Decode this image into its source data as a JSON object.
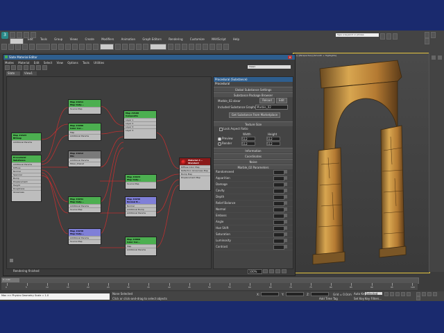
{
  "app": {
    "title": "Slate Material Editor",
    "menu": [
      "Edit",
      "Tools",
      "Group",
      "Views",
      "Create",
      "Modifiers",
      "Animation",
      "Graph Editors",
      "Rendering",
      "Customize",
      "MAXScript",
      "Help"
    ],
    "search_placeholder": "Type a keyword or phrase",
    "viewport_label": "[+] [Perspective] [Smooth + Highlights]"
  },
  "sme": {
    "title": "Slate Material Editor",
    "menu": [
      "Modes",
      "Material",
      "Edit",
      "Select",
      "View",
      "Options",
      "Tools",
      "Utilities"
    ],
    "panel_tabs": [
      "Slate",
      "View1"
    ],
    "view_dropdown": "View1",
    "status": "Rendering finished"
  },
  "nodes": {
    "bitmap": {
      "title": "Map #2423",
      "sub": "Bitmap",
      "rows": [
        "Additional Params"
      ]
    },
    "substance": {
      "title": "Procedural",
      "sub": "Substance",
      "rows": [
        "Additional Params",
        "Diffuse",
        "Normal",
        "Specular",
        "Bump",
        "Displacement",
        "Height",
        "Roughness",
        "Glossiness"
      ]
    },
    "out1": {
      "title": "Map #2211",
      "sub": "Map Outp...",
      "rows": [
        "Source Map"
      ]
    },
    "cc1": {
      "title": "Map #2206",
      "sub": "Color Cor...",
      "rows": [
        "Map",
        "Additional Params"
      ]
    },
    "comp": {
      "title": "Map #2100",
      "sub": "Composite",
      "rows": [
        "Layer 1",
        "Layer 2",
        "Layer 3",
        "Layer 4",
        "Layer 5",
        "Layer 6"
      ]
    },
    "mix": {
      "title": "Map #2212",
      "sub": "Mix",
      "rows": [
        "Additional Params",
        "Mixer_Shared"
      ]
    },
    "out2": {
      "title": "Map #2224",
      "sub": "Map Outp...",
      "rows": [
        "Source Map"
      ]
    },
    "out3": {
      "title": "Map #2231",
      "sub": "Map Outp...",
      "rows": [
        "Additional Params",
        "Source Map"
      ]
    },
    "nb": {
      "title": "Map #2236",
      "sub": "Normal B...",
      "rows": [
        "Normal",
        "Additional Bump",
        "Additional Params"
      ]
    },
    "out4": {
      "title": "Map #2238",
      "sub": "Map Outp...",
      "rows": [
        "Additional Params",
        "Source Map"
      ]
    },
    "cc2": {
      "title": "Map #2069",
      "sub": "Color Cor...",
      "rows": [
        "Map",
        "Additional Params"
      ]
    },
    "mat": {
      "title": "Material #...",
      "sub": "Standard",
      "rows": [
        "Diffuse Color Map",
        "Reflection Glossiness Map",
        "Bump Map",
        "Displacement Map"
      ]
    }
  },
  "props": {
    "header": "Procedural (Substance)",
    "subheader": "Procedural",
    "global_settings": "Global Substance Settings",
    "package_browser": "Substance Package Browser",
    "file_name": "Marble_02.sbsar",
    "reload": "Reload",
    "edit": "Edit",
    "included_graphs_label": "Included Substance Graphs:",
    "included_graph": "Marble_02",
    "marketplace": "Get Substance From Marketplace",
    "texture_size": "Texture Size",
    "lock_aspect": "Lock Aspect Ratio",
    "width": "Width",
    "height": "Height",
    "preview_label": "Preview",
    "render_label": "Render",
    "size_val": "512",
    "information": "Information",
    "coordinates": "Coordinates",
    "noise": "Noise",
    "parameters": "Marble_02 Parameters",
    "params": [
      "Randomseed",
      "Apparition",
      "Damage",
      "Cavity",
      "Depth",
      "Relief Balance",
      "Normal",
      "Emboss",
      "Angle",
      "Hue Shift",
      "Saturation",
      "Luminosity",
      "Contrast"
    ],
    "zoom": "100%"
  },
  "timeline": {
    "frame": "0 / 100",
    "ticks": [
      "0",
      "5",
      "10",
      "15",
      "20",
      "25",
      "30",
      "35",
      "40",
      "45",
      "50",
      "55",
      "60",
      "65",
      "70",
      "75",
      "80",
      "85",
      "90",
      "95",
      "100"
    ]
  },
  "status": {
    "script": "Max >> Physics Geometry Scale = 1.0",
    "selection": "None Selected",
    "prompt": "Click or click-and-drag to select objects",
    "x_label": "X:",
    "y_label": "Y:",
    "z_label": "Z:",
    "grid": "Grid = 0.0cm",
    "autokey": "Auto Key",
    "selected": "Selected",
    "setkey": "Set Key",
    "key_filters": "Key Filters...",
    "add_time_tag": "Add Time Tag"
  }
}
